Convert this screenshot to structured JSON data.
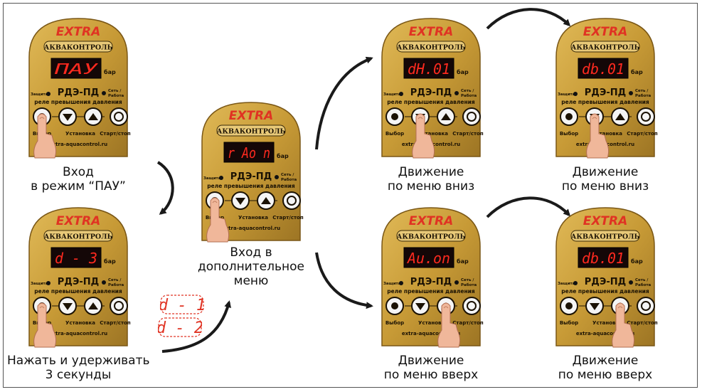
{
  "device": {
    "logo": "EXTRA",
    "brand": "АКВАКОНТРОЛЬ",
    "unit": "бар",
    "model": "РДЭ-ПД",
    "led_left": "Защита",
    "led_right_1": "Сеть /",
    "led_right_2": "Работа",
    "subtitle": "реле превышения давления",
    "btn_select": "Выбор",
    "btn_set": "Установка",
    "btn_startstop": "Старт/стоп",
    "site": "extra-aquacontrol.ru"
  },
  "colors": {
    "body": "#c79a36",
    "body_dark": "#7a5716",
    "display": "#140707",
    "digits": "#ff2a1f",
    "logo_red": "#e03323",
    "arrow": "#1a1a1a",
    "finger": "#f0b79a"
  },
  "panels": [
    {
      "id": "p1",
      "display": "ПАУ",
      "label": [
        "Вход",
        "в режим “ПАУ”"
      ],
      "pressed": "select"
    },
    {
      "id": "p2",
      "display": "d - 3",
      "label": [
        "Нажать и удерживать",
        "3 секунды"
      ],
      "pressed": "select"
    },
    {
      "id": "p3",
      "display": "r Ao n",
      "label": [
        "Вход в",
        "дополнительное",
        "меню"
      ],
      "pressed": "select"
    },
    {
      "id": "p4",
      "display": "dH.01",
      "label": [
        "Движение",
        "по меню вниз"
      ],
      "pressed": "down"
    },
    {
      "id": "p5",
      "display": "db.01",
      "label": [
        "Движение",
        "по меню вниз"
      ],
      "pressed": "down"
    },
    {
      "id": "p6",
      "display": "Au.on",
      "label": [
        "Движение",
        "по меню вверх"
      ],
      "pressed": "up"
    },
    {
      "id": "p7",
      "display": "db.01",
      "label": [
        "Движение",
        "по меню вверх"
      ],
      "pressed": "up"
    }
  ],
  "countdown": [
    "d - 1",
    "d - 2"
  ]
}
